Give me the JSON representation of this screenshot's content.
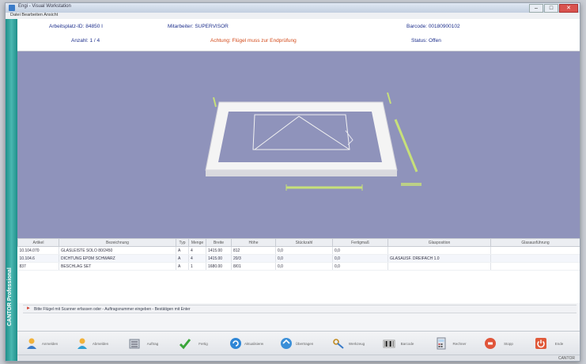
{
  "window": {
    "title": "Engi - Visual Workstation",
    "menu": "Datei  Bearbeiten  Ansicht",
    "buttons": {
      "minimize": "–",
      "maximize": "□",
      "close": "✕"
    }
  },
  "sidebar": {
    "label": "CANTOR Professional"
  },
  "info": {
    "arbeitsplatz": "Arbeitsplatz-ID: 84850 I",
    "mitarbeiter": "Mitarbeiter: SUPERVISOR",
    "barcode": "Barcode: 00180900102",
    "anzahl": "Anzahl: 1 / 4",
    "warnung": "Achtung: Flügel muss zur Endprüfung",
    "status": "Status: Offen"
  },
  "table": {
    "headers": [
      "Artikel",
      "Bezeichnung",
      "Typ",
      "Menge",
      "Breite",
      "Höhe",
      "Stückzahl",
      "Fertigmaß",
      "Glasposition",
      "Glasausführung"
    ],
    "rows": [
      [
        "10.104.070",
        "GLASLEISTE SOLO 80/2450",
        "A",
        "4",
        "1415.00",
        "812",
        "0,0",
        "0,0",
        "",
        ""
      ],
      [
        "10.104.6",
        "DICHTUNG EPDM SCHWARZ",
        "A",
        "4",
        "1415.00",
        "20/3",
        "0,0",
        "0,0",
        "GLASAUSF. DREIFACH 1.0",
        ""
      ],
      [
        "837",
        "BESCHLAG SET",
        "A",
        "1",
        "1680.00",
        "8/01",
        "0,0",
        "0,0",
        "",
        ""
      ]
    ]
  },
  "status_line": {
    "text": "Bitte Flügel mit Scanner erfassen oder - Auftragsnummer eingeben - Bestätigen mit Enter"
  },
  "toolbar": {
    "buttons": [
      {
        "id": "login",
        "label": "Anmelden"
      },
      {
        "id": "logout",
        "label": "Abmelden"
      },
      {
        "id": "list",
        "label": "Auftrag"
      },
      {
        "id": "ok",
        "label": "Fertig"
      },
      {
        "id": "refresh",
        "label": "Aktualisieren"
      },
      {
        "id": "sync",
        "label": "Übertragen"
      },
      {
        "id": "key",
        "label": "Werkzeug"
      },
      {
        "id": "scan",
        "label": "Barcode"
      },
      {
        "id": "calc",
        "label": "Rechner"
      },
      {
        "id": "stop",
        "label": "Stopp"
      },
      {
        "id": "exit",
        "label": "Ende"
      }
    ]
  },
  "bottom": {
    "text": "CANTOR"
  },
  "colors": {
    "viewport": "#8f93bb",
    "sidebar": "#2ea39d",
    "frame": "#f5f5f5",
    "dimension": "#c7e07a"
  }
}
